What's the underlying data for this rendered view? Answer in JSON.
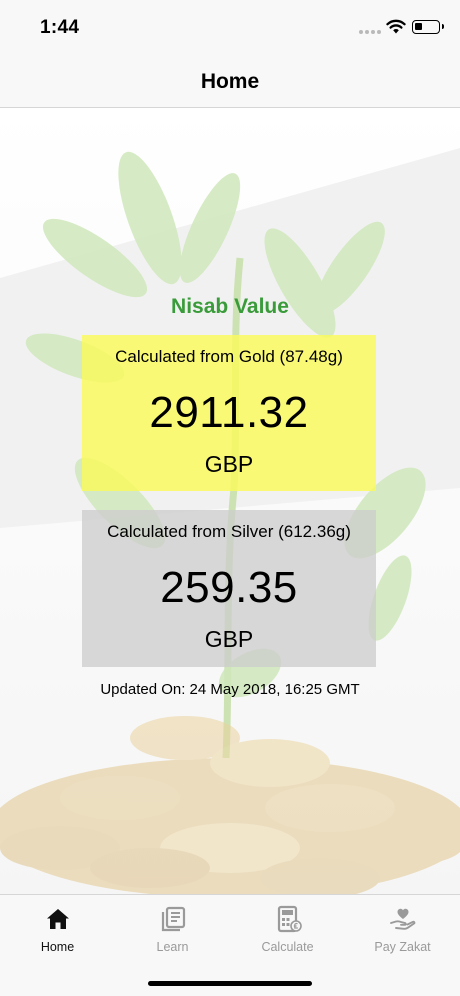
{
  "status_bar": {
    "time": "1:44",
    "icons": [
      "signal-dots-icon",
      "wifi-icon",
      "battery-icon"
    ]
  },
  "nav": {
    "title": "Home"
  },
  "main": {
    "section_title": "Nisab Value",
    "section_title_color": "#3a9b3a",
    "gold_card": {
      "label": "Calculated from Gold (87.48g)",
      "value": "2911.32",
      "currency": "GBP",
      "color": "#fafa5a"
    },
    "silver_card": {
      "label": "Calculated from Silver (612.36g)",
      "value": "259.35",
      "currency": "GBP",
      "color": "#cdcdcd"
    },
    "updated": "Updated On: 24 May 2018, 16:25 GMT"
  },
  "tab_bar": {
    "tabs": [
      {
        "label": "Home",
        "icon": "home-icon",
        "active": true
      },
      {
        "label": "Learn",
        "icon": "book-icon",
        "active": false
      },
      {
        "label": "Calculate",
        "icon": "calculator-icon",
        "active": false
      },
      {
        "label": "Pay Zakat",
        "icon": "hand-heart-icon",
        "active": false
      }
    ]
  }
}
